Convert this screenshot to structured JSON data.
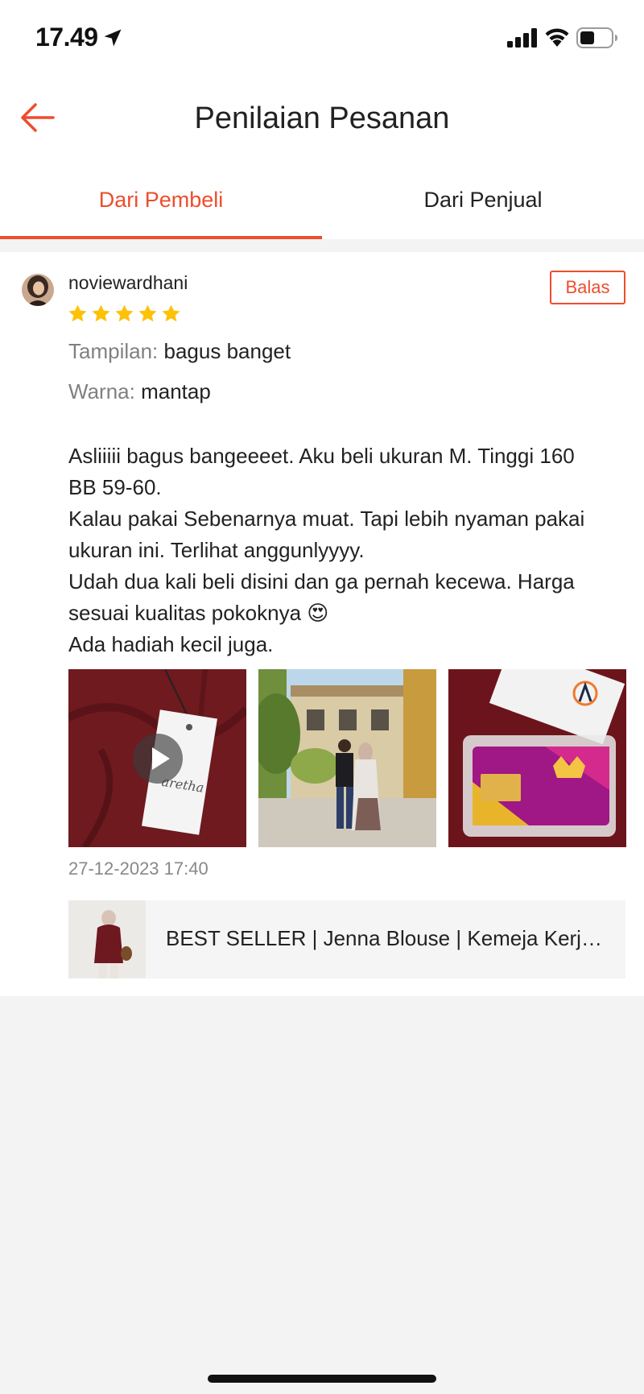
{
  "status_bar": {
    "time": "17.49"
  },
  "header": {
    "title": "Penilaian Pesanan"
  },
  "tabs": [
    {
      "label": "Dari Pembeli",
      "active": true
    },
    {
      "label": "Dari Penjual",
      "active": false
    }
  ],
  "review": {
    "username": "noviewardhani",
    "rating": 5,
    "reply_label": "Balas",
    "attributes": [
      {
        "label": "Tampilan:",
        "value": "bagus banget"
      },
      {
        "label": "Warna:",
        "value": "mantap"
      }
    ],
    "text_lines": [
      "Asliiiii bagus bangeeeet. Aku beli ukuran M. Tinggi 160",
      "BB 59-60.",
      "Kalau pakai Sebenarnya muat. Tapi lebih nyaman pakai",
      "ukuran ini. Terlihat anggunlyyyy.",
      "Udah dua kali beli disini dan ga pernah kecewa. Harga",
      "sesuai kualitas pokoknya 😍",
      "Ada hadiah kecil juga."
    ],
    "date": "27-12-2023 17:40",
    "media_logo_text": "aretha",
    "product_name": "BEST SELLER | Jenna Blouse | Kemeja Kerja Wanita"
  },
  "colors": {
    "accent": "#ee4d2d",
    "star": "#ffc107",
    "background": "#f3f3f3"
  }
}
